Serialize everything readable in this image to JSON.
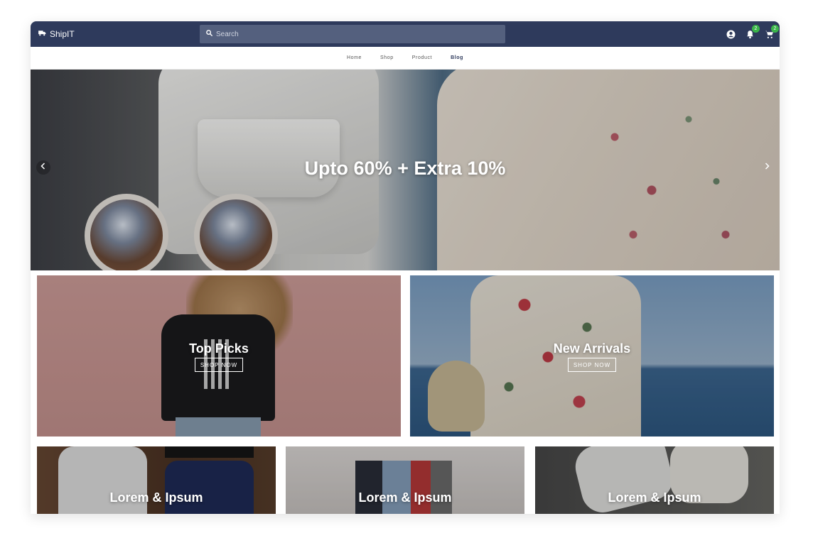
{
  "app": {
    "brand_name": "ShipIT",
    "brand_icon": "truck-icon"
  },
  "header": {
    "search_placeholder": "Search",
    "icons": [
      "account-icon",
      "bell-icon",
      "cart-icon"
    ],
    "notification_count": "2",
    "cart_count": "2"
  },
  "nav": {
    "items": [
      {
        "label": "Home",
        "active": false
      },
      {
        "label": "Shop",
        "active": false
      },
      {
        "label": "Product",
        "active": false
      },
      {
        "label": "Blog",
        "active": true
      }
    ]
  },
  "hero": {
    "headline": "Upto 60% + Extra 10%",
    "prev_icon": "chevron-left-icon",
    "next_icon": "chevron-right-icon"
  },
  "promos": [
    {
      "title": "Top Picks",
      "button": "SHOP NOW"
    },
    {
      "title": "New Arrivals",
      "button": "SHOP NOW"
    }
  ],
  "categories": [
    {
      "title": "Lorem & Ipsum"
    },
    {
      "title": "Lorem & Ipsum"
    },
    {
      "title": "Lorem & Ipsum"
    }
  ],
  "colors": {
    "header_bg": "#2e3a5c",
    "search_bg": "#54607e",
    "badge": "#3bb54a",
    "nav_active": "#2e3a5c"
  }
}
